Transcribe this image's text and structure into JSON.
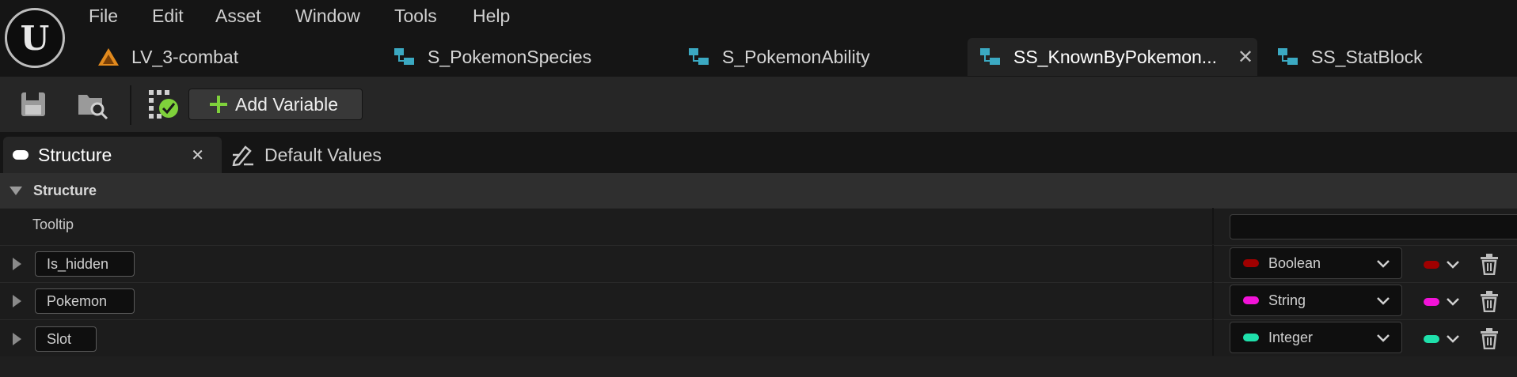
{
  "menu": [
    "File",
    "Edit",
    "Asset",
    "Window",
    "Tools",
    "Help"
  ],
  "doc_tabs": [
    {
      "label": "LV_3-combat",
      "icon": "level-icon",
      "active": false
    },
    {
      "label": "S_PokemonSpecies",
      "icon": "struct-icon",
      "active": false
    },
    {
      "label": "S_PokemonAbility",
      "icon": "struct-icon",
      "active": false
    },
    {
      "label": "SS_KnownByPokemon...",
      "icon": "struct-icon",
      "active": true
    },
    {
      "label": "SS_StatBlock",
      "icon": "struct-icon",
      "active": false
    }
  ],
  "toolbar": {
    "add_variable_label": "Add Variable"
  },
  "panel_tabs": {
    "structure": "Structure",
    "default_values": "Default Values"
  },
  "details": {
    "category": "Structure",
    "tooltip_label": "Tooltip",
    "tooltip_value": "",
    "variables": [
      {
        "name": "Is_hidden",
        "type": "Boolean",
        "color": "#a00000"
      },
      {
        "name": "Pokemon",
        "type": "String",
        "color": "#f213d8"
      },
      {
        "name": "Slot",
        "type": "Integer",
        "color": "#1fe0ab"
      }
    ]
  },
  "colors": {
    "accent_green": "#7fd13b",
    "struct_icon": "#3ba9c2",
    "level_icon": "#e28a1d"
  }
}
